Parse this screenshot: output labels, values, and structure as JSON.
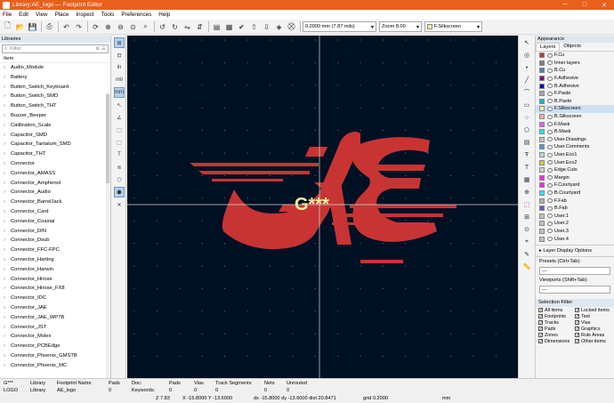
{
  "window": {
    "title": "Library:AE_logo — Footprint Editor",
    "controls": [
      "─",
      "□",
      "✕"
    ]
  },
  "menu": [
    "File",
    "Edit",
    "View",
    "Place",
    "Inspect",
    "Tools",
    "Preferences",
    "Help"
  ],
  "toolbar": {
    "grid": "0.2000 mm (7.87 mils)",
    "zoom": "Zoom 8.00",
    "layer": "F.Silkscreen"
  },
  "libraries": {
    "header": "Libraries",
    "filter_placeholder": "Filter",
    "column": "Item",
    "items": [
      "Audio_Module",
      "Battery",
      "Button_Switch_Keyboard",
      "Button_Switch_SMD",
      "Button_Switch_THT",
      "Buzzer_Beeper",
      "Calibration_Scale",
      "Capacitor_SMD",
      "Capacitor_Tantalum_SMD",
      "Capacitor_THT",
      "Connector",
      "Connector_AMASS",
      "Connector_Amphenol",
      "Connector_Audio",
      "Connector_BarrelJack",
      "Connector_Card",
      "Connector_Coaxial",
      "Connector_DIN",
      "Connector_Dsub",
      "Connector_FFC-FPC",
      "Connector_Harting",
      "Connector_Harwin",
      "Connector_Hirose",
      "Connector_Hirose_FX8",
      "Connector_IDC",
      "Connector_JAE",
      "Connector_JAE_WP7B",
      "Connector_JST",
      "Connector_Molex",
      "Connector_PCBEdge",
      "Connector_Phoenix_GMSTB",
      "Connector_Phoenix_MC"
    ]
  },
  "left_tools": [
    "⊞",
    "⊡",
    "in",
    "mil",
    "mm",
    "↖",
    "∠",
    "⬚",
    "⬚",
    "T",
    "≋",
    "⬡",
    "⬢",
    "✕"
  ],
  "right_tools": [
    "↖",
    "◎",
    "•",
    "╱",
    "⌒",
    "▭",
    "○",
    "⬠",
    "▤",
    "Ŧ",
    "T",
    "▦",
    "⊕",
    "⬚",
    "⊞",
    "⊙",
    "⌖",
    "✎",
    "📏"
  ],
  "canvas": {
    "ref_text": "G***"
  },
  "appearance": {
    "header": "Appearance",
    "tabs": [
      "Layers",
      "Objects"
    ],
    "layers": [
      {
        "name": "F.Cu",
        "color": "#c83434"
      },
      {
        "name": "Inner layers",
        "color": "#7f7f7f"
      },
      {
        "name": "B.Cu",
        "color": "#4d7fc4"
      },
      {
        "name": "F.Adhesive",
        "color": "#840084"
      },
      {
        "name": "B.Adhesive",
        "color": "#0000c8"
      },
      {
        "name": "F.Paste",
        "color": "#b4a0a0"
      },
      {
        "name": "B.Paste",
        "color": "#00c2c2"
      },
      {
        "name": "F.Silkscreen",
        "color": "#f2eda1"
      },
      {
        "name": "B.Silkscreen",
        "color": "#e8b2a7"
      },
      {
        "name": "F.Mask",
        "color": "#d864ff"
      },
      {
        "name": "B.Mask",
        "color": "#02ffee"
      },
      {
        "name": "User.Drawings",
        "color": "#c2c2c2"
      },
      {
        "name": "User.Comments",
        "color": "#5994dc"
      },
      {
        "name": "User.Eco1",
        "color": "#b4dbd2"
      },
      {
        "name": "User.Eco2",
        "color": "#d8c852"
      },
      {
        "name": "Edge.Cuts",
        "color": "#d0d2cd"
      },
      {
        "name": "Margin",
        "color": "#ff26e2"
      },
      {
        "name": "F.Courtyard",
        "color": "#ff26e2"
      },
      {
        "name": "B.Courtyard",
        "color": "#26e9ff"
      },
      {
        "name": "F.Fab",
        "color": "#afafaf"
      },
      {
        "name": "B.Fab",
        "color": "#585dc4"
      },
      {
        "name": "User.1",
        "color": "#c2c2c2"
      },
      {
        "name": "User.2",
        "color": "#c2c2c2"
      },
      {
        "name": "User.3",
        "color": "#c2c2c2"
      },
      {
        "name": "User.4",
        "color": "#c2c2c2"
      }
    ],
    "active_layer": "F.Silkscreen",
    "layer_display": "Layer Display Options",
    "presets_label": "Presets (Ctrl+Tab):",
    "presets_value": "---",
    "viewports_label": "Viewports (Shift+Tab):",
    "viewports_value": "---",
    "selection_filter": "Selection Filter",
    "filters": [
      "All items",
      "Locked items",
      "Footprints",
      "Text",
      "Tracks",
      "Vias",
      "Pads",
      "Graphics",
      "Zones",
      "Rule Areas",
      "Dimensions",
      "Other items"
    ]
  },
  "status": {
    "r1": [
      "G***",
      "Library",
      "Footprint Name",
      "Pads",
      "Doc:",
      "Pads",
      "Vias",
      "Track Segments",
      "Nets",
      "Unrouted"
    ],
    "r2": [
      "LOGO",
      "Library",
      "AE_logo",
      "0",
      "Keywords:",
      "0",
      "0",
      "0",
      "0",
      "0"
    ],
    "r3": [
      "Z 7.83",
      "X -15.8000  Y -13.6000",
      "dx -15.8000  dy -13.6000  dist 20.8471",
      "grid 0.2000",
      "mm"
    ]
  }
}
